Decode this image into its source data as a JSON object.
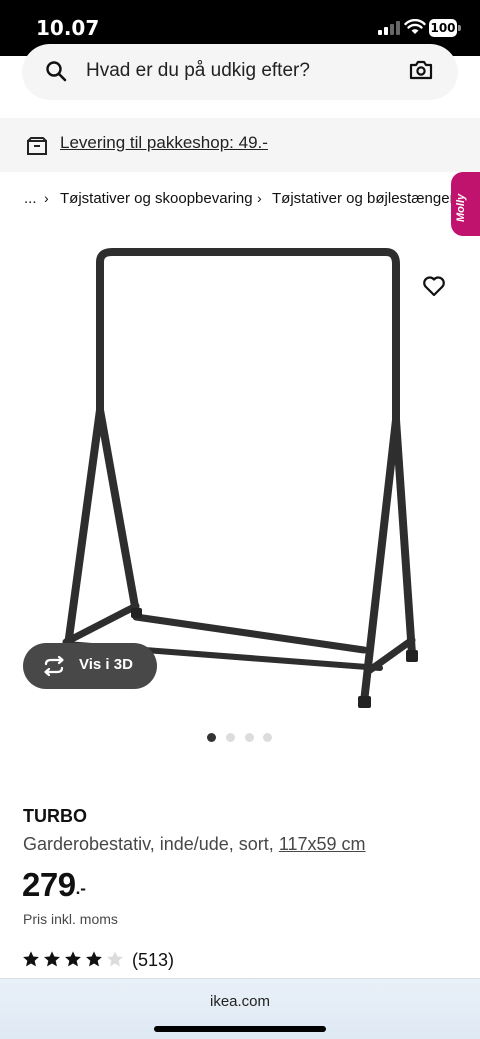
{
  "status_bar": {
    "time": "10.07",
    "battery": "100"
  },
  "search": {
    "placeholder": "Hvad er du på udkig efter?"
  },
  "delivery": {
    "text": "Levering til pakkeshop: 49.-"
  },
  "breadcrumb": {
    "ellipsis": "...",
    "items": [
      "Tøjstativer og skoopbevaring",
      "Tøjstativer og bøjlestænger"
    ]
  },
  "assistant": {
    "label": "Molly"
  },
  "product": {
    "view_3d_label": "Vis i 3D",
    "name": "TURBO",
    "description": "Garderobestativ, inde/ude, sort, ",
    "dimensions": "117x59 cm",
    "price": "279",
    "price_suffix": ".-",
    "vat_note": "Pris inkl. moms",
    "rating_value": 4,
    "rating_max": 5,
    "review_count": "(513)"
  },
  "carousel": {
    "total": 4,
    "active": 1
  },
  "browser": {
    "url": "ikea.com"
  },
  "colors": {
    "accent": "#c0136d",
    "dark": "#111111",
    "button": "#484848"
  }
}
